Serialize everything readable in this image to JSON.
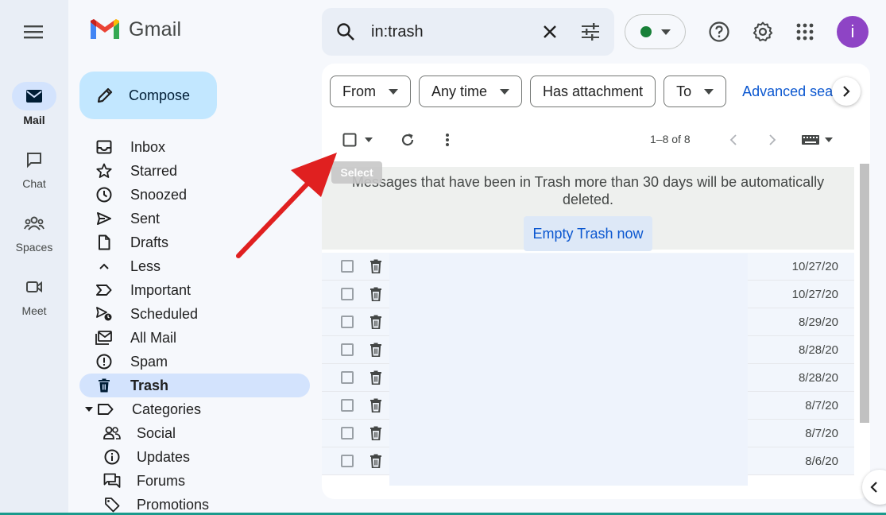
{
  "rail": {
    "items": [
      {
        "label": "Mail",
        "icon": "mail-icon",
        "active": true
      },
      {
        "label": "Chat",
        "icon": "chat-icon"
      },
      {
        "label": "Spaces",
        "icon": "spaces-icon"
      },
      {
        "label": "Meet",
        "icon": "meet-icon"
      }
    ]
  },
  "app": {
    "name": "Gmail"
  },
  "compose": {
    "label": "Compose"
  },
  "nav": {
    "items": [
      {
        "label": "Inbox",
        "icon": "inbox-icon"
      },
      {
        "label": "Starred",
        "icon": "star-icon"
      },
      {
        "label": "Snoozed",
        "icon": "clock-icon"
      },
      {
        "label": "Sent",
        "icon": "send-icon"
      },
      {
        "label": "Drafts",
        "icon": "draft-icon"
      },
      {
        "label": "Less",
        "icon": "chevron-up-icon"
      },
      {
        "label": "Important",
        "icon": "important-icon"
      },
      {
        "label": "Scheduled",
        "icon": "scheduled-icon"
      },
      {
        "label": "All Mail",
        "icon": "all-mail-icon"
      },
      {
        "label": "Spam",
        "icon": "spam-icon"
      },
      {
        "label": "Trash",
        "icon": "trash-icon",
        "active": true
      },
      {
        "label": "Categories",
        "icon": "label-icon"
      },
      {
        "label": "Social",
        "icon": "people-icon"
      },
      {
        "label": "Updates",
        "icon": "info-icon"
      },
      {
        "label": "Forums",
        "icon": "forum-icon"
      },
      {
        "label": "Promotions",
        "icon": "tag-icon"
      }
    ]
  },
  "search": {
    "value": "in:trash"
  },
  "filters": {
    "from": "From",
    "any_time": "Any time",
    "has_attachment": "Has attachment",
    "to": "To",
    "advanced": "Advanced search"
  },
  "toolbar": {
    "pager": "1–8 of 8",
    "tooltip": "Select"
  },
  "banner": {
    "message": "Messages that have been in Trash more than 30 days will be automatically deleted.",
    "button": "Empty Trash now"
  },
  "messages": [
    {
      "date": "10/27/20"
    },
    {
      "date": "10/27/20"
    },
    {
      "date": "8/29/20"
    },
    {
      "date": "8/28/20"
    },
    {
      "date": "8/28/20"
    },
    {
      "date": "8/7/20"
    },
    {
      "date": "8/7/20"
    },
    {
      "date": "8/6/20"
    }
  ],
  "user": {
    "initial": "i"
  },
  "colors": {
    "accent": "#0b57d0",
    "compose": "#c2e7ff",
    "active_nav": "#d3e3fd",
    "avatar": "#8e44c5",
    "status_online": "#188038",
    "annotation_arrow": "#e02020"
  }
}
